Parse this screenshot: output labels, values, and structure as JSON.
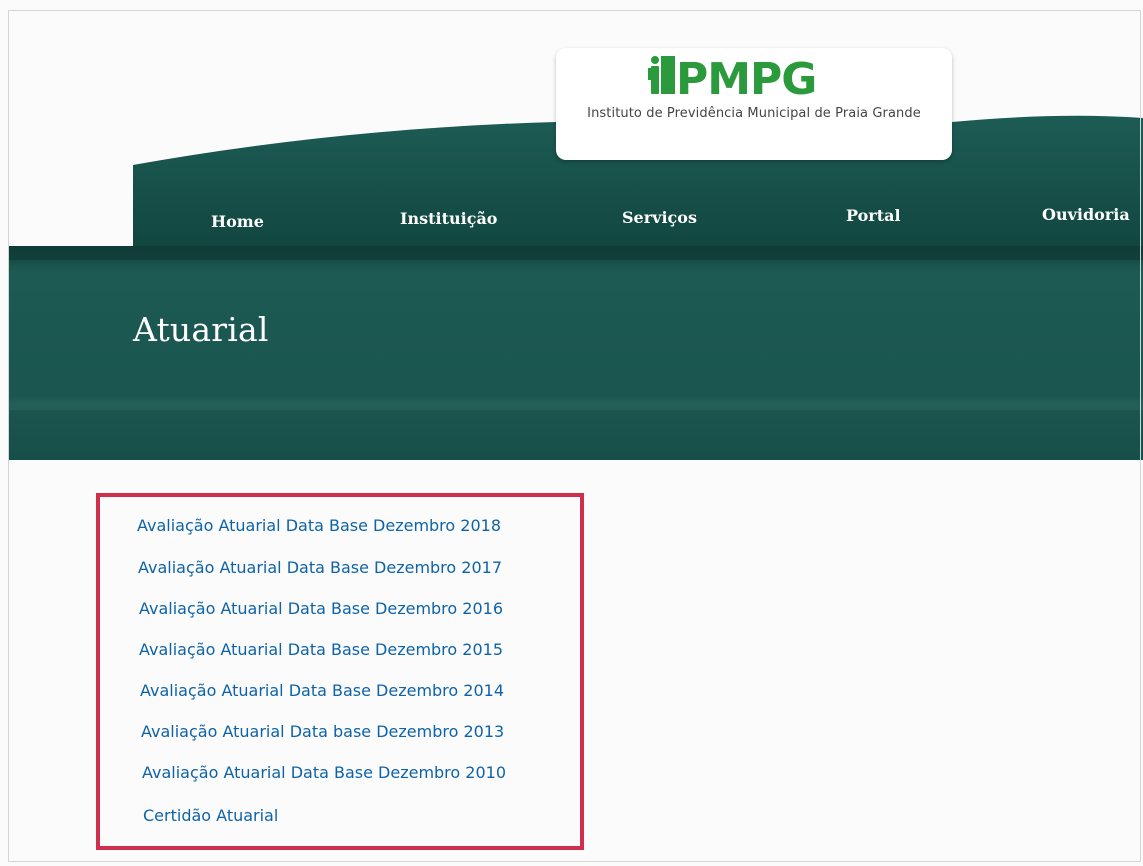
{
  "brand": {
    "logo_text": "iPMPG",
    "subtitle": "Instituto de Previdência Municipal de Praia Grande",
    "accent_color": "#2a9a3c"
  },
  "nav": {
    "items": [
      {
        "label": "Home"
      },
      {
        "label": "Instituição"
      },
      {
        "label": "Serviços"
      },
      {
        "label": "Portal"
      },
      {
        "label": "Ouvidoria"
      }
    ]
  },
  "main": {
    "page_title": "Atuarial",
    "documents": [
      {
        "label": "Avaliação Atuarial Data Base Dezembro 2018"
      },
      {
        "label": "Avaliação Atuarial Data Base Dezembro 2017"
      },
      {
        "label": "Avaliação Atuarial Data Base Dezembro 2016"
      },
      {
        "label": "Avaliação Atuarial Data Base Dezembro 2015"
      },
      {
        "label": "Avaliação Atuarial Data Base Dezembro 2014"
      },
      {
        "label": "Avaliação Atuarial Data base Dezembro 2013"
      },
      {
        "label": "Avaliação Atuarial Data Base Dezembro 2010"
      },
      {
        "label": "Certidão Atuarial"
      }
    ],
    "highlight_color": "#cf2f4c"
  },
  "colors": {
    "header_green": "#14504a",
    "band_green": "#1b5751",
    "link_blue": "#0e63a8"
  }
}
